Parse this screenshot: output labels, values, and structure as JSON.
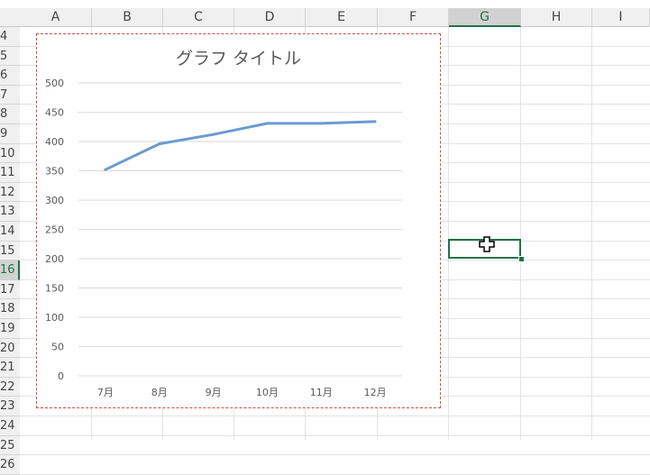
{
  "columns": [
    "A",
    "B",
    "C",
    "D",
    "E",
    "F",
    "G",
    "H",
    "I"
  ],
  "selected_column": "G",
  "rows": [
    "4",
    "5",
    "6",
    "7",
    "8",
    "9",
    "10",
    "11",
    "12",
    "13",
    "14",
    "15",
    "16",
    "17",
    "18",
    "19",
    "20",
    "21",
    "22",
    "23",
    "24",
    "25",
    "26"
  ],
  "selected_row": "16",
  "chart_data": {
    "type": "line",
    "title": "グラフ タイトル",
    "categories": [
      "7月",
      "8月",
      "9月",
      "10月",
      "11月",
      "12月"
    ],
    "series": [
      {
        "values": [
          352,
          396,
          412,
          431,
          431,
          434
        ],
        "color": "#6b9bd1"
      }
    ],
    "ylim": [
      0,
      500
    ],
    "yticks": [
      0,
      50,
      100,
      150,
      200,
      250,
      300,
      350,
      400,
      450,
      500
    ],
    "grid": true,
    "legend": "none"
  },
  "colors": {
    "selection": "#217346",
    "chart_border": "#c0504d",
    "gridline": "#d9d9d9"
  },
  "cursor_icon": "cross-cursor-icon"
}
